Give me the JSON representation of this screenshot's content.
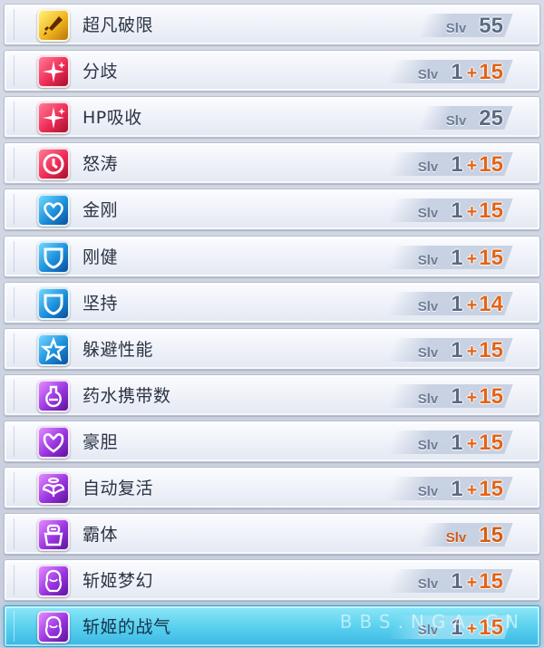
{
  "skills": [
    {
      "name": "超凡破限",
      "icon": "sword-icon",
      "icon_color": "#f2b51e",
      "slv_label": "Slv",
      "base": "55",
      "plus": "",
      "bonus": ""
    },
    {
      "name": "分歧",
      "icon": "sparkle-icon",
      "icon_color": "#ee2c55",
      "slv_label": "Slv",
      "base": "1",
      "plus": "+",
      "bonus": "15"
    },
    {
      "name": "HP吸收",
      "icon": "sparkle-icon",
      "icon_color": "#ee2c55",
      "slv_label": "Slv",
      "base": "25",
      "plus": "",
      "bonus": ""
    },
    {
      "name": "怒涛",
      "icon": "clock-icon",
      "icon_color": "#ee2c55",
      "slv_label": "Slv",
      "base": "1",
      "plus": "+",
      "bonus": "15"
    },
    {
      "name": "金刚",
      "icon": "heart-icon",
      "icon_color": "#1b8fdc",
      "slv_label": "Slv",
      "base": "1",
      "plus": "+",
      "bonus": "15"
    },
    {
      "name": "刚健",
      "icon": "shield-icon",
      "icon_color": "#1b8fdc",
      "slv_label": "Slv",
      "base": "1",
      "plus": "+",
      "bonus": "15"
    },
    {
      "name": "坚持",
      "icon": "shield-icon",
      "icon_color": "#1b8fdc",
      "slv_label": "Slv",
      "base": "1",
      "plus": "+",
      "bonus": "14"
    },
    {
      "name": "躲避性能",
      "icon": "star-icon",
      "icon_color": "#1b8fdc",
      "slv_label": "Slv",
      "base": "1",
      "plus": "+",
      "bonus": "15"
    },
    {
      "name": "药水携带数",
      "icon": "potion-icon",
      "icon_color": "#9a34e0",
      "slv_label": "Slv",
      "base": "1",
      "plus": "+",
      "bonus": "15"
    },
    {
      "name": "豪胆",
      "icon": "muscle-icon",
      "icon_color": "#9a34e0",
      "slv_label": "Slv",
      "base": "1",
      "plus": "+",
      "bonus": "15"
    },
    {
      "name": "自动复活",
      "icon": "angel-icon",
      "icon_color": "#9a34e0",
      "slv_label": "Slv",
      "base": "1",
      "plus": "+",
      "bonus": "15"
    },
    {
      "name": "霸体",
      "icon": "armor-icon",
      "icon_color": "#9a34e0",
      "slv_label": "Slv",
      "base": "15",
      "plus": "",
      "bonus": "",
      "orange": true
    },
    {
      "name": "斩姬梦幻",
      "icon": "portrait-icon",
      "icon_color": "#9a34e0",
      "slv_label": "Slv",
      "base": "1",
      "plus": "+",
      "bonus": "15"
    },
    {
      "name": "斩姬的战气",
      "icon": "portrait-icon",
      "icon_color": "#9a34e0",
      "slv_label": "Slv",
      "base": "1",
      "plus": "+",
      "bonus": "15",
      "selected": true
    }
  ],
  "watermark": "BBS.NGA.CN"
}
